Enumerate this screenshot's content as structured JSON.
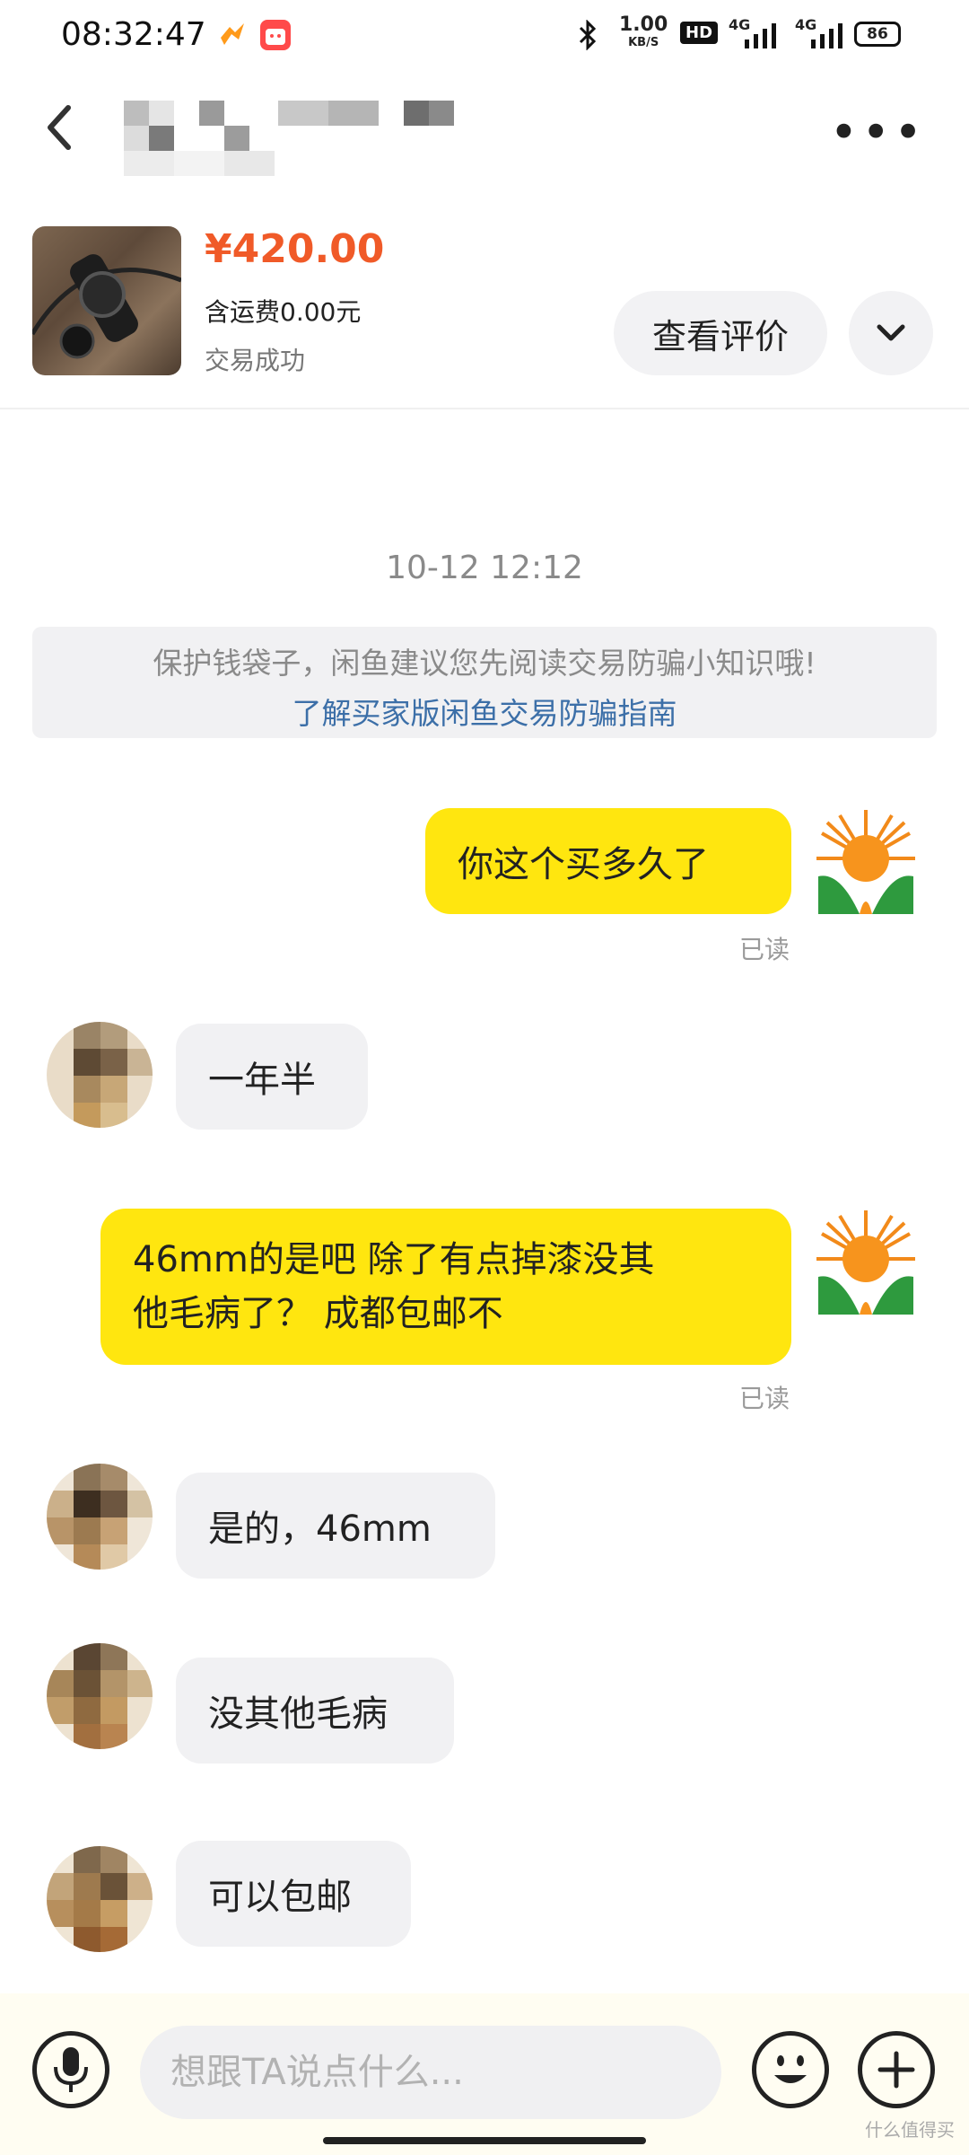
{
  "status_bar": {
    "time": "08:32:47",
    "net_speed": "1.00",
    "net_unit": "KB/S",
    "hd_label": "HD",
    "sim1": "4G",
    "sim2": "4G",
    "battery": "86"
  },
  "product": {
    "price": "¥420.00",
    "shipping": "含运费0.00元",
    "status": "交易成功",
    "review_button": "查看评价"
  },
  "chat": {
    "timestamp": "10-12 12:12",
    "notice_text": "保护钱袋子，闲鱼建议您先阅读交易防骗小知识哦!",
    "notice_link": "了解买家版闲鱼交易防骗指南",
    "read_label": "已读",
    "messages": [
      {
        "from": "me",
        "text": "你这个买多久了"
      },
      {
        "from": "peer",
        "text": "一年半"
      },
      {
        "from": "me",
        "text_line1": "46mm的是吧 除了有点掉漆没其",
        "text_line2": "他毛病了？ 成都包邮不"
      },
      {
        "from": "peer",
        "text": "是的，46mm"
      },
      {
        "from": "peer",
        "text": "没其他毛病"
      },
      {
        "from": "peer",
        "text": "可以包邮"
      }
    ]
  },
  "input": {
    "placeholder": "想跟TA说点什么..."
  },
  "watermark": "什么值得买",
  "colors": {
    "accent_yellow": "#ffe60f",
    "price_orange": "#f05a28",
    "link_blue": "#3c6fa8"
  }
}
